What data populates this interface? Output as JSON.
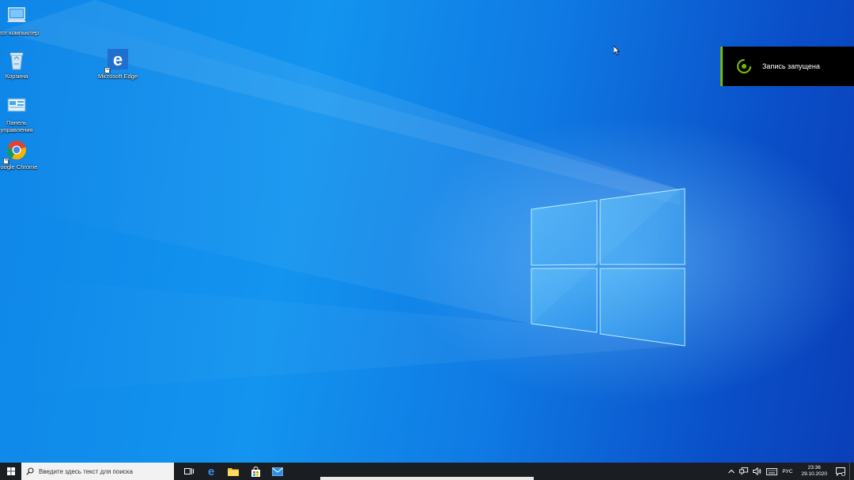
{
  "desktop_icons": [
    {
      "name": "this-pc",
      "label": "Этот компьютер"
    },
    {
      "name": "recycle-bin",
      "label": "Корзина"
    },
    {
      "name": "control-panel",
      "label": "Панель управления"
    },
    {
      "name": "google-chrome",
      "label": "Google Chrome"
    },
    {
      "name": "microsoft-edge",
      "label": "Microsoft Edge"
    }
  ],
  "toast": {
    "message": "Запись запущена",
    "icon": "record-icon",
    "accent_color": "#76b900"
  },
  "taskbar": {
    "search_placeholder": "Введите здесь текст для поиска",
    "pinned_apps": [
      "task-view",
      "microsoft-edge",
      "file-explorer",
      "microsoft-store",
      "mail"
    ],
    "tray": {
      "language": "РУС",
      "time": "23:36",
      "date": "29.10.2020"
    }
  }
}
